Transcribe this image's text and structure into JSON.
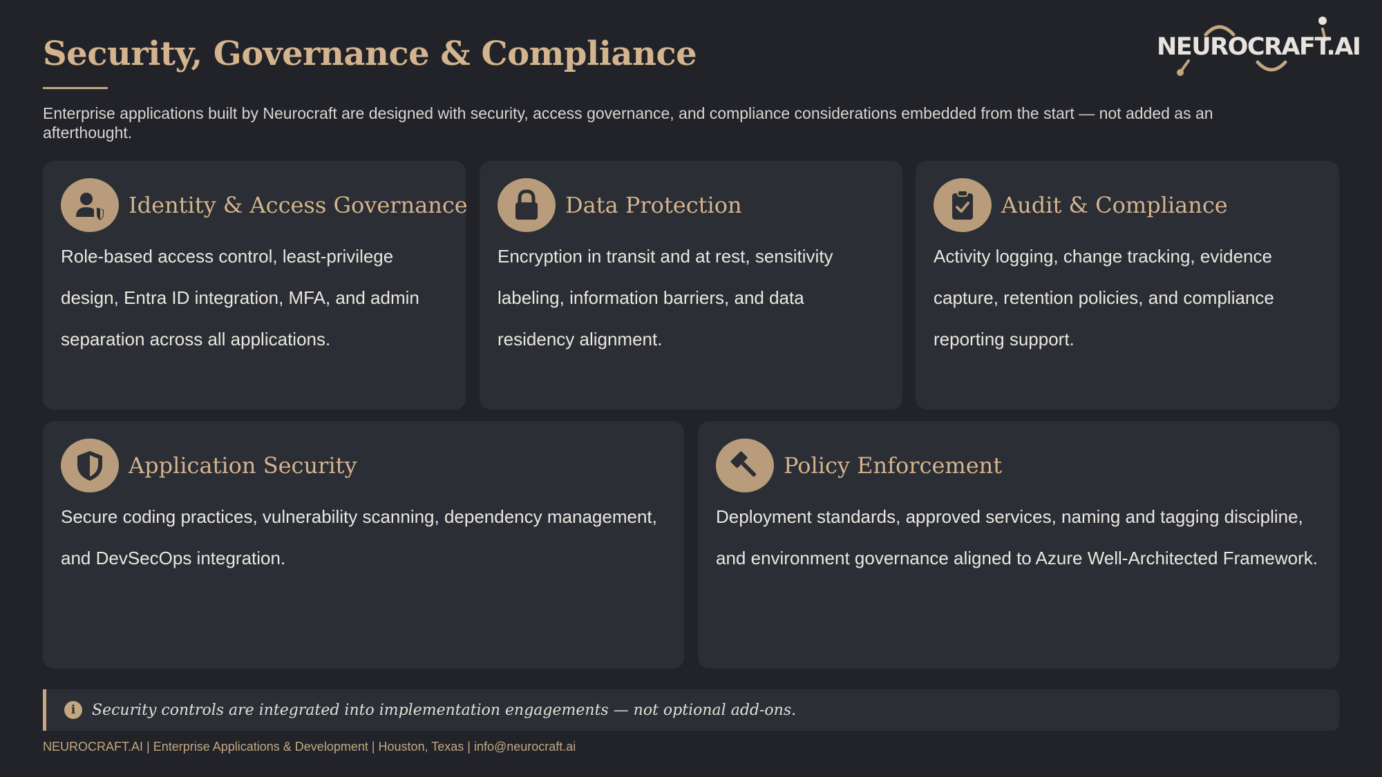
{
  "header": {
    "title": "Security, Governance & Compliance",
    "subtitle": "Enterprise applications built by Neurocraft are designed with security, access governance, and compliance considerations embedded from the start — not added as an afterthought."
  },
  "logo": {
    "text": "NEUROCRAFT.AI"
  },
  "cards": [
    {
      "title": "Identity & Access Governance",
      "icon": "user-shield-icon",
      "body": "Role-based access control, least-privilege design, Entra ID integration, MFA, and admin separation across all applications."
    },
    {
      "title": "Data Protection",
      "icon": "lock-icon",
      "body": "Encryption in transit and at rest, sensitivity labeling, information barriers, and data residency alignment."
    },
    {
      "title": "Audit & Compliance",
      "icon": "clipboard-check-icon",
      "body": "Activity logging, change tracking, evidence capture, retention policies, and compliance reporting support."
    },
    {
      "title": "Application Security",
      "icon": "shield-icon",
      "body": "Secure coding practices, vulnerability scanning, dependency management, and DevSecOps integration."
    },
    {
      "title": "Policy Enforcement",
      "icon": "gavel-icon",
      "body": "Deployment standards, approved services, naming and tagging discipline, and environment governance aligned to Azure Well-Architected Framework."
    }
  ],
  "note": {
    "icon": "info-icon",
    "text": "Security controls are integrated into implementation engagements — not optional add-ons."
  },
  "footer": {
    "text": "NEUROCRAFT.AI | Enterprise Applications & Development | Houston, Texas | info@neurocraft.ai"
  },
  "colors": {
    "background": "#212329",
    "card": "#2b2e34",
    "accent": "#d4b48e",
    "icon_circle": "#b89c7b",
    "text": "#ebe7e1"
  }
}
